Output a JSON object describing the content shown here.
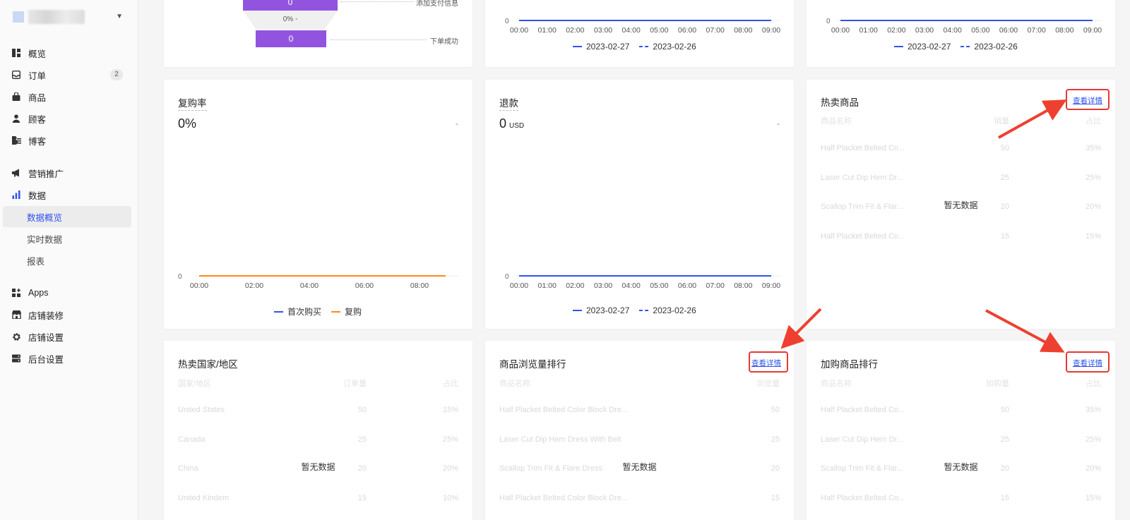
{
  "sidebar": {
    "items": [
      {
        "label": "概览",
        "icon": "dashboard-icon"
      },
      {
        "label": "订单",
        "icon": "inbox-icon",
        "badge": "2"
      },
      {
        "label": "商品",
        "icon": "shopping-bag-icon"
      },
      {
        "label": "顾客",
        "icon": "user-icon"
      },
      {
        "label": "博客",
        "icon": "blog-icon"
      },
      {
        "label": "营销推广",
        "icon": "megaphone-icon"
      },
      {
        "label": "数据",
        "icon": "bar-chart-icon"
      },
      {
        "label": "数据概览",
        "sub": true,
        "active": true
      },
      {
        "label": "实时数据",
        "sub": true
      },
      {
        "label": "报表",
        "sub": true
      },
      {
        "label": "Apps",
        "icon": "apps-icon"
      },
      {
        "label": "店铺装修",
        "icon": "store-icon"
      },
      {
        "label": "店铺设置",
        "icon": "gear-icon"
      },
      {
        "label": "后台设置",
        "icon": "server-icon"
      }
    ]
  },
  "funnel": {
    "top_value": "0",
    "top_label": "添加支付信息",
    "mid_text": "0% -",
    "bottom_value": "0",
    "bottom_label": "下单成功"
  },
  "top_charts": {
    "x_ticks": [
      "00:00",
      "01:00",
      "02:00",
      "03:00",
      "04:00",
      "05:00",
      "06:00",
      "07:00",
      "08:00",
      "09:00"
    ],
    "y_zero": "0",
    "legend": [
      "2023-02-27",
      "2023-02-26"
    ]
  },
  "repurchase": {
    "title": "复购率",
    "value": "0%",
    "dash": "-",
    "y_zero": "0",
    "x_ticks": [
      "00:00",
      "02:00",
      "04:00",
      "06:00",
      "08:00"
    ],
    "legend": [
      "首次购买",
      "复购"
    ]
  },
  "refund": {
    "title": "退款",
    "value": "0",
    "unit": "USD",
    "dash": "-",
    "y_zero": "0",
    "x_ticks": [
      "00:00",
      "01:00",
      "02:00",
      "03:00",
      "04:00",
      "05:00",
      "06:00",
      "07:00",
      "08:00",
      "09:00"
    ],
    "legend": [
      "2023-02-27",
      "2023-02-26"
    ]
  },
  "hot_products": {
    "title": "热卖商品",
    "link": "查看详情",
    "empty": "暂无数据",
    "headers": [
      "商品名称",
      "销量",
      "占比"
    ],
    "rows": [
      [
        "Half Placket Belted Co...",
        "50",
        "35%"
      ],
      [
        "Laser Cut Dip Hem Dr...",
        "25",
        "25%"
      ],
      [
        "Scallop Trim Fit & Flar...",
        "20",
        "20%"
      ],
      [
        "Half Placket Belted Co...",
        "15",
        "15%"
      ]
    ]
  },
  "hot_countries": {
    "title": "热卖国家/地区",
    "empty": "暂无数据",
    "headers": [
      "国家/地区",
      "订单量",
      "占比"
    ],
    "rows": [
      [
        "United States",
        "50",
        "15%"
      ],
      [
        "Canada",
        "25",
        "25%"
      ],
      [
        "China",
        "20",
        "20%"
      ],
      [
        "United Kindem",
        "15",
        "10%"
      ]
    ]
  },
  "views_rank": {
    "title": "商品浏览量排行",
    "link": "查看详情",
    "empty": "暂无数据",
    "headers": [
      "商品名称",
      "浏览量"
    ],
    "rows": [
      [
        "Half Placket Belted Color Block Dre...",
        "50"
      ],
      [
        "Laser Cut Dip Hem Dress With Belt",
        "25"
      ],
      [
        "Scallop Trim Fit & Flare Dress",
        "20"
      ],
      [
        "Half Placket Belted Color Block Dre...",
        "15"
      ]
    ]
  },
  "cart_rank": {
    "title": "加购商品排行",
    "link": "查看详情",
    "empty": "暂无数据",
    "headers": [
      "商品名称",
      "加购量",
      "占比"
    ],
    "rows": [
      [
        "Half Placket Belted Co...",
        "50",
        "35%"
      ],
      [
        "Laser Cut Dip Hem Dr...",
        "25",
        "25%"
      ],
      [
        "Scallop Trim Fit & Flar...",
        "20",
        "20%"
      ],
      [
        "Half Placket Belted Co...",
        "15",
        "15%"
      ]
    ]
  },
  "colors": {
    "accent": "#2f54eb",
    "orange": "#fa8c16",
    "funnel": "#9254de",
    "highlight": "#e53935"
  }
}
